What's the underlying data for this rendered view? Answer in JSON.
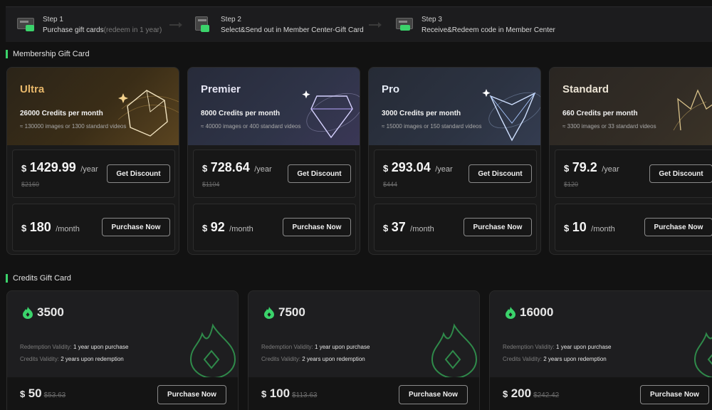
{
  "steps": [
    {
      "label": "Step 1",
      "text": "Purchase gift cards",
      "note": "(redeem in 1 year)"
    },
    {
      "label": "Step 2",
      "text": "Select&Send out in Member Center-Gift Card",
      "note": ""
    },
    {
      "label": "Step 3",
      "text": "Receive&Redeem code in Member Center",
      "note": ""
    }
  ],
  "membership": {
    "title": "Membership Gift Card",
    "get_discount_label": "Get Discount",
    "purchase_label": "Purchase Now",
    "currency": "$",
    "per_year": "/year",
    "per_month": "/month",
    "plans": [
      {
        "name": "Ultra",
        "credits": "26000 Credits per month",
        "sub": "≈ 130000 images or 1300 standard videos",
        "yearly": "1429.99",
        "original": "$2160",
        "monthly": "180",
        "accent": "#e7b76a"
      },
      {
        "name": "Premier",
        "credits": "8000 Credits per month",
        "sub": "≈ 40000 images or 400 standard videos",
        "yearly": "728.64",
        "original": "$1104",
        "monthly": "92",
        "accent": "#c9b8ff"
      },
      {
        "name": "Pro",
        "credits": "3000 Credits per month",
        "sub": "≈ 15000 images or 150 standard videos",
        "yearly": "293.04",
        "original": "$444",
        "monthly": "37",
        "accent": "#a9c8ff"
      },
      {
        "name": "Standard",
        "credits": "660 Credits per month",
        "sub": "≈ 3300 images or 33 standard videos",
        "yearly": "79.2",
        "original": "$120",
        "monthly": "10",
        "accent": "#d9c28a"
      }
    ]
  },
  "credits": {
    "title": "Credits Gift Card",
    "validity_label": "Redemption Validity:",
    "validity_value": "1 year upon purchase",
    "credits_validity_label": "Credits Validity:",
    "credits_validity_value": "2 years upon redemption",
    "purchase_label": "Purchase Now",
    "currency": "$",
    "cards": [
      {
        "amount": "3500",
        "price": "50",
        "original": "$53.63"
      },
      {
        "amount": "7500",
        "price": "100",
        "original": "$113.63"
      },
      {
        "amount": "16000",
        "price": "200",
        "original": "$242.42"
      }
    ]
  },
  "colors": {
    "accent_green": "#3bd36b",
    "background": "#121212"
  }
}
